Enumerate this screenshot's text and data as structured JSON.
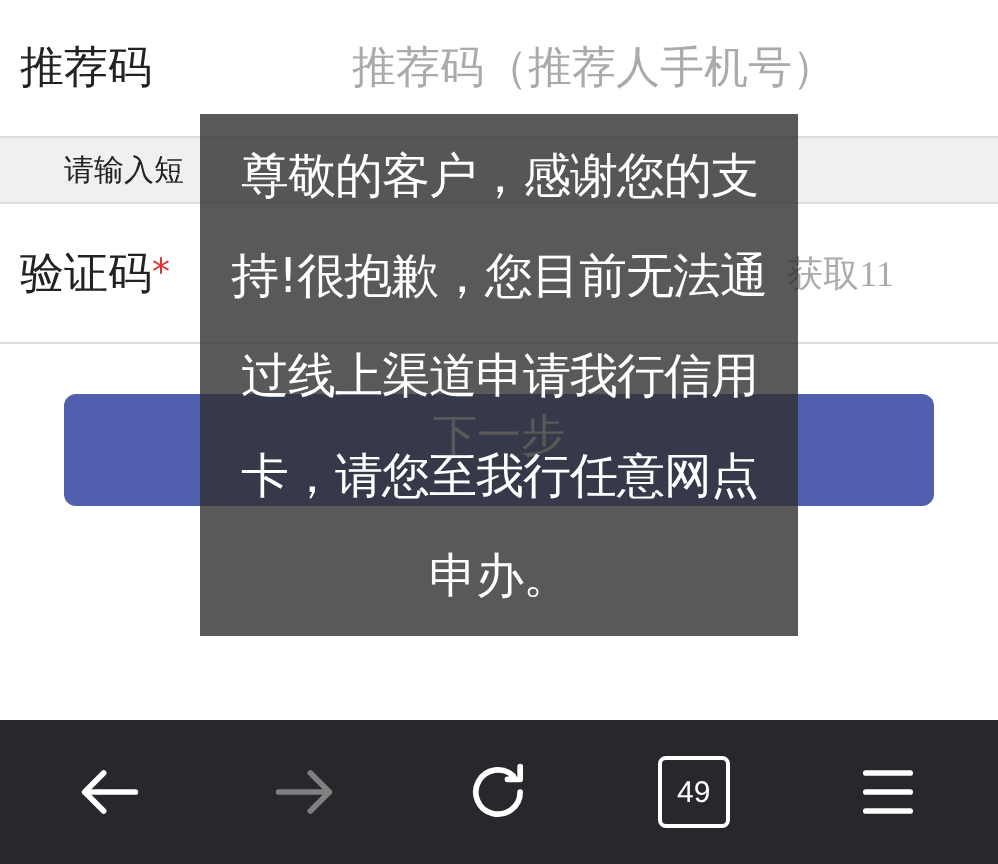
{
  "form": {
    "referrer": {
      "label": "推荐码",
      "placeholder": "推荐码（推荐人手机号）"
    },
    "notice": "请输入短",
    "code": {
      "label": "验证码",
      "required_mark": "*",
      "get_code": "获取11"
    },
    "next_button": "下一步"
  },
  "toast": {
    "lines": [
      "尊敬的客户，感谢您的支",
      "持!很抱歉，您目前无法通",
      "过线上渠道申请我行信用",
      "卡，请您至我行任意网点",
      "申办。"
    ]
  },
  "toolbar": [
    {
      "kind": "back",
      "disabled": false
    },
    {
      "kind": "forward",
      "disabled": true
    },
    {
      "kind": "reload",
      "disabled": false
    },
    {
      "kind": "tabs",
      "disabled": false,
      "count": "49"
    },
    {
      "kind": "menu",
      "disabled": false
    }
  ]
}
